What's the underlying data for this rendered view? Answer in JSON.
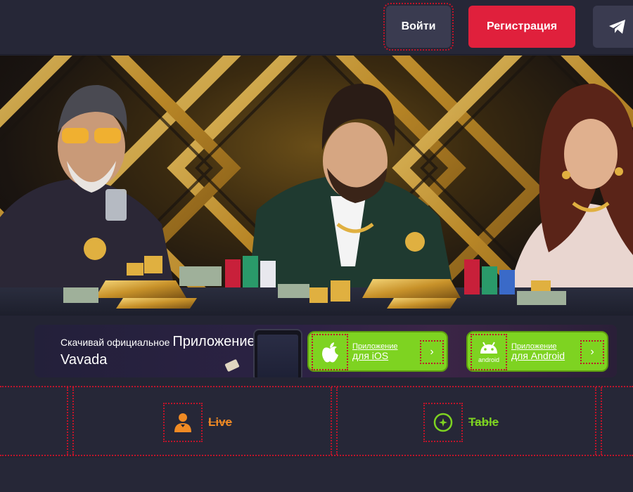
{
  "header": {
    "login_label": "Войти",
    "register_label": "Регистрация",
    "telegram_icon": "telegram-icon"
  },
  "app_banner": {
    "line1_prefix": "Скачивай официальное",
    "line1_highlight": "Приложение",
    "line2": "Vavada",
    "ios": {
      "label_small": "Приложение",
      "label_big": "для iOS",
      "icon": "apple-icon"
    },
    "android": {
      "label_small": "Приложение",
      "label_big": "для Android",
      "icon": "android-icon",
      "icon_caption": "android"
    }
  },
  "categories": [
    {
      "label": "Live",
      "icon": "live-dealer-icon",
      "color": "#f08a24"
    },
    {
      "label": "Table",
      "icon": "table-games-icon",
      "color": "#7ed321"
    }
  ],
  "colors": {
    "accent_red": "#e0203c",
    "accent_green": "#7ed321",
    "accent_orange": "#f08a24",
    "header_bg": "#262737"
  }
}
